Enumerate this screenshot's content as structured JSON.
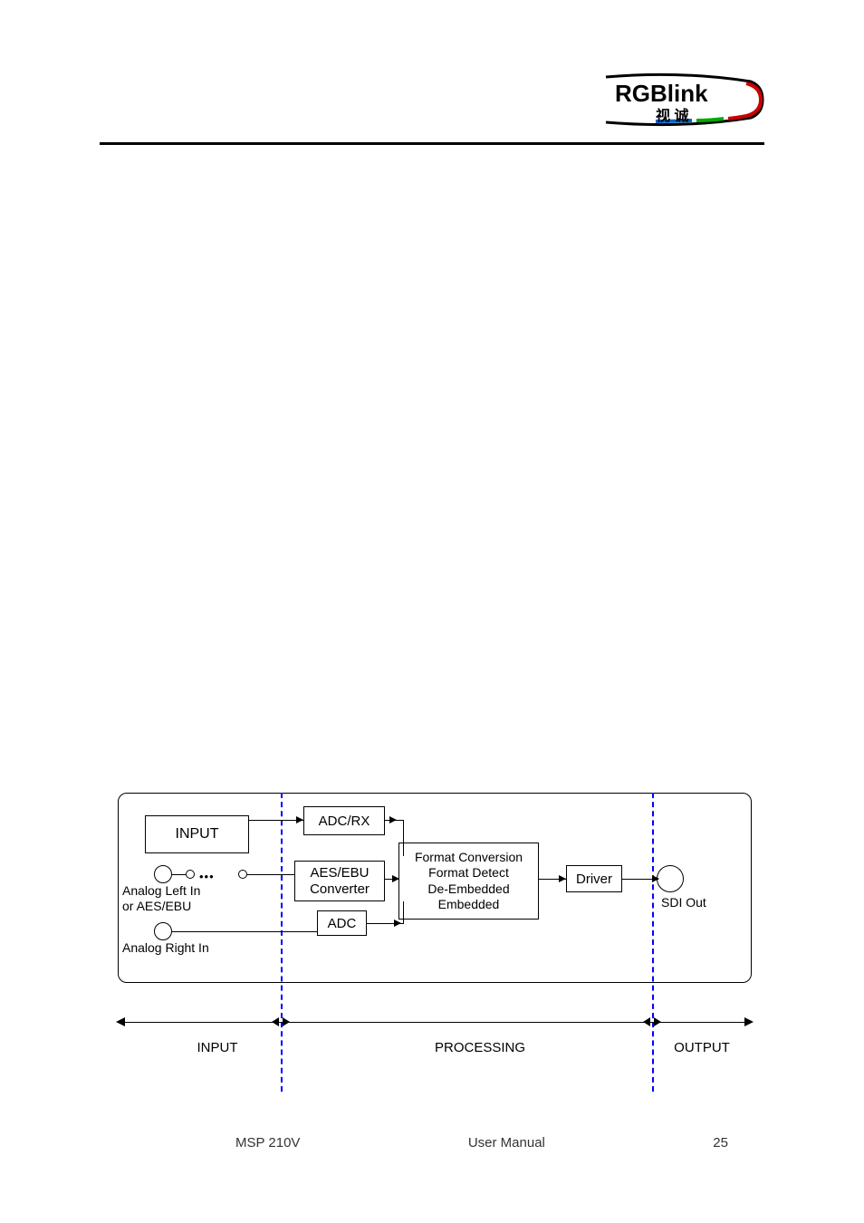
{
  "logo": {
    "main": "RGBlink",
    "sub": "视 诚"
  },
  "diagram": {
    "input_box": "INPUT",
    "adcrx": "ADC/RX",
    "aes_ebu": "AES/EBU\nConverter",
    "adc": "ADC",
    "processing": "Format Conversion\nFormat Detect\nDe-Embedded\nEmbedded",
    "driver": "Driver",
    "analog_left": "Analog Left In\nor AES/EBU",
    "analog_right": "Analog Right In",
    "sdi_out": "SDI Out"
  },
  "sections": {
    "input": "INPUT",
    "processing": "PROCESSING",
    "output": "OUTPUT"
  },
  "footer": {
    "model": "MSP 210V",
    "doc": "User Manual",
    "page": "25"
  }
}
